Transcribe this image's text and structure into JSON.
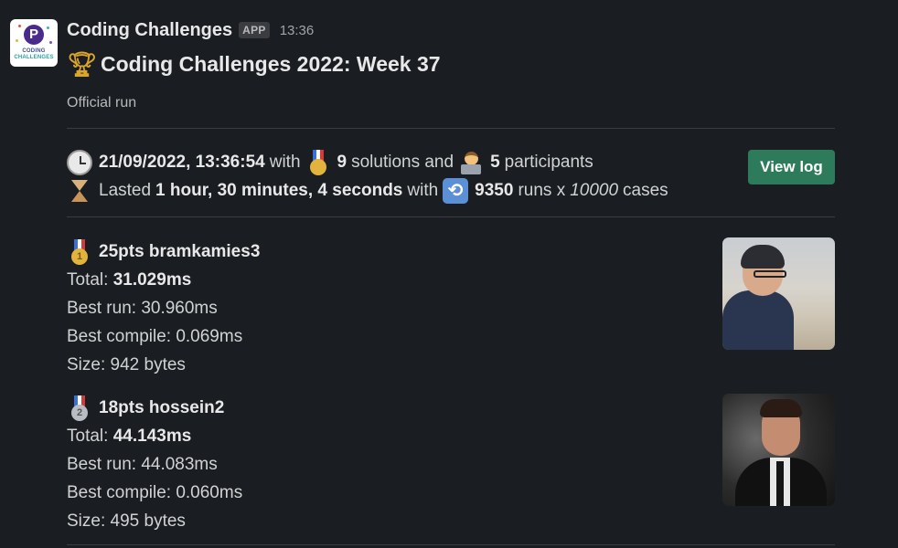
{
  "header": {
    "sender": "Coding Challenges",
    "badge": "APP",
    "time": "13:36"
  },
  "app_logo": {
    "letter": "P",
    "line1": "CODING",
    "line2": "CHALLENGES"
  },
  "message": {
    "title": "Coding Challenges 2022: Week 37",
    "subtitle": "Official run",
    "stats": {
      "datetime": "21/09/2022, 13:36:54",
      "with1": "with",
      "solutions_count": "9",
      "solutions_label": "solutions and",
      "participants_count": "5",
      "participants_label": "participants",
      "lasted_label": "Lasted",
      "duration": "1 hour, 30 minutes, 4 seconds",
      "with2": "with",
      "runs_count": "9350",
      "runs_label": "runs x",
      "cases_count": "10000",
      "cases_label": "cases"
    },
    "view_log_label": "View log"
  },
  "entries": [
    {
      "medal": "1",
      "medal_type": "gold",
      "heading": "25pts bramkamies3",
      "total_label": "Total:",
      "total_value": "31.029ms",
      "best_run": "Best run: 30.960ms",
      "best_compile": "Best compile: 0.069ms",
      "size": "Size: 942 bytes"
    },
    {
      "medal": "2",
      "medal_type": "silver",
      "heading": "18pts hossein2",
      "total_label": "Total:",
      "total_value": "44.143ms",
      "best_run": "Best run: 44.083ms",
      "best_compile": "Best compile: 0.060ms",
      "size": "Size: 495 bytes"
    }
  ],
  "colors": {
    "background": "#1a1d21",
    "button": "#2e7b5b",
    "text": "#d1d2d3"
  }
}
